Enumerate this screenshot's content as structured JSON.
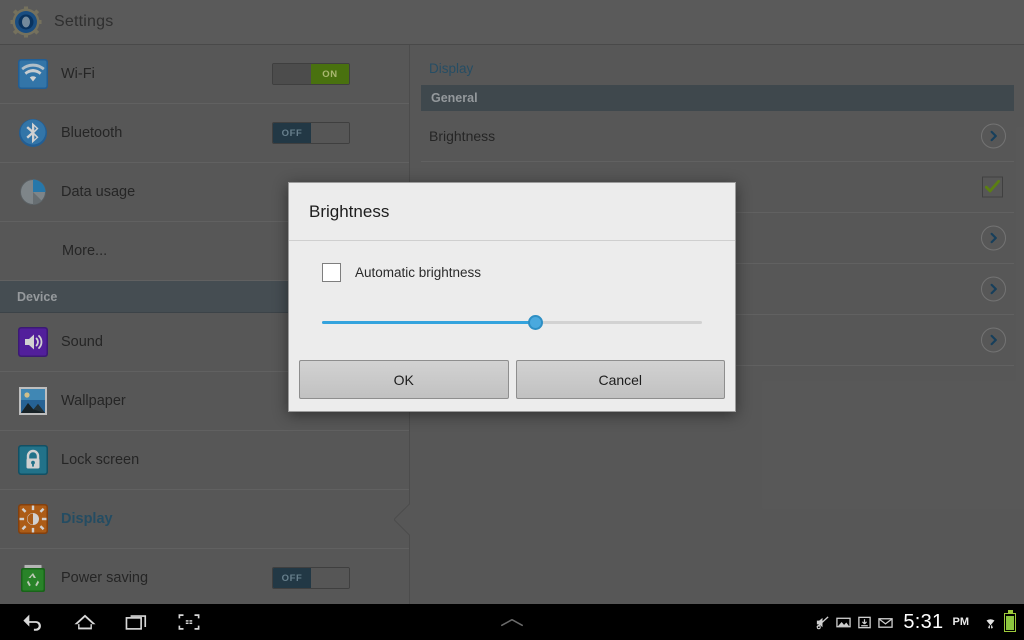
{
  "titlebar": {
    "app_title": "Settings",
    "icon": "settings-gear-icon"
  },
  "sidebar": {
    "items": [
      {
        "label": "Wi-Fi",
        "icon": "wifi-icon",
        "toggle": {
          "state": "on",
          "label": "ON"
        }
      },
      {
        "label": "Bluetooth",
        "icon": "bluetooth-icon",
        "toggle": {
          "state": "off",
          "label": "OFF"
        }
      },
      {
        "label": "Data usage",
        "icon": "data-usage-icon"
      },
      {
        "label": "More...",
        "icon": "none"
      }
    ],
    "device_section": {
      "header": "Device"
    },
    "device_items": [
      {
        "label": "Sound",
        "icon": "sound-icon"
      },
      {
        "label": "Wallpaper",
        "icon": "wallpaper-icon"
      },
      {
        "label": "Lock screen",
        "icon": "lock-icon"
      },
      {
        "label": "Display",
        "icon": "display-brightness-icon",
        "selected": true
      },
      {
        "label": "Power saving",
        "icon": "power-saving-icon",
        "toggle": {
          "state": "off",
          "label": "OFF"
        }
      }
    ]
  },
  "content": {
    "breadcrumb": "Display",
    "section_header": "General",
    "rows": [
      {
        "label": "Brightness",
        "accessory": "chevron-right-icon"
      },
      {
        "label": "",
        "accessory": "green-checkmark-icon"
      },
      {
        "label": "",
        "accessory": "chevron-right-icon"
      },
      {
        "label": "",
        "accessory": "chevron-right-icon"
      },
      {
        "label": "",
        "accessory": "chevron-right-icon"
      }
    ]
  },
  "dialog": {
    "title": "Brightness",
    "checkbox_label": "Automatic brightness",
    "checkbox_checked": false,
    "slider": {
      "value": 56,
      "min": 0,
      "max": 100
    },
    "ok_label": "OK",
    "cancel_label": "Cancel"
  },
  "system_bar": {
    "nav": [
      {
        "name": "back-icon"
      },
      {
        "name": "home-icon"
      },
      {
        "name": "recents-icon"
      },
      {
        "name": "screenshot-icon"
      }
    ],
    "expand_icon": "chevron-up-icon",
    "status_icons": [
      "mute-vibrate-icon",
      "screenshot-captured-icon",
      "usb-download-icon",
      "email-icon"
    ],
    "time": "5:31",
    "meridiem": "PM",
    "wifi_icon": "wifi-status-icon",
    "battery_icon": "battery-full-icon"
  },
  "colors": {
    "accent_blue": "#34a3dd",
    "selected_text": "#2c5d78",
    "toggle_on": "#5a8a13",
    "toggle_off": "#2a4555",
    "checkmark_green": "#6f9c17",
    "panel_bg": "#6b6b6b",
    "dialog_bg": "#ececec"
  }
}
